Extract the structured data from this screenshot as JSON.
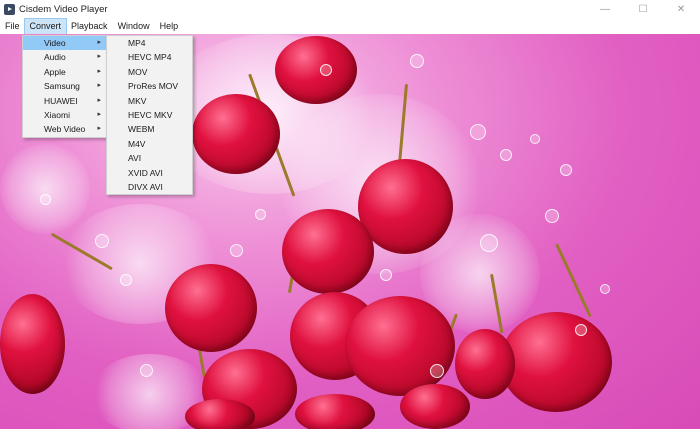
{
  "window": {
    "title": "Cisdem Video Player"
  },
  "menubar": {
    "items": [
      "File",
      "Convert",
      "Playback",
      "Window",
      "Help"
    ]
  },
  "convert_menu": {
    "items": [
      "Video",
      "Audio",
      "Apple",
      "Samsung",
      "HUAWEI",
      "Xiaomi",
      "Web Video"
    ]
  },
  "video_submenu": {
    "items": [
      "MP4",
      "HEVC MP4",
      "MOV",
      "ProRes MOV",
      "MKV",
      "HEVC MKV",
      "WEBM",
      "M4V",
      "AVI",
      "XVID AVI",
      "DIVX AVI"
    ]
  },
  "icons": {
    "minimize": "minimize-icon",
    "maximize": "maximize-icon",
    "close": "close-icon",
    "submenu": "chevron-right-icon"
  },
  "colors": {
    "menu_highlight": "#91c9f7",
    "menubar_active": "#cce4f7",
    "video_background": "#e15fc2"
  }
}
